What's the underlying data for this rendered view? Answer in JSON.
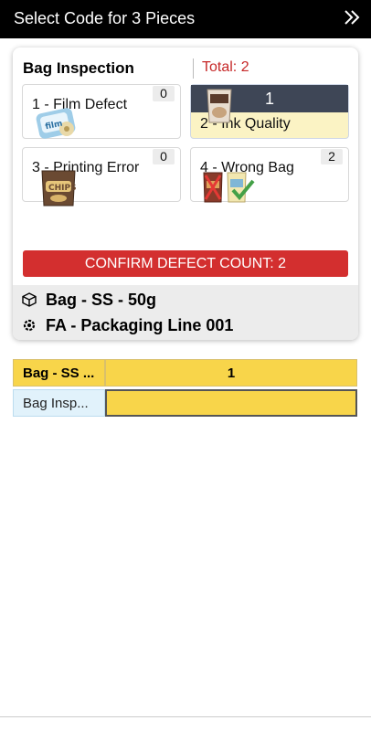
{
  "header": {
    "title": "Select Code for 3 Pieces",
    "expand_icon": "double-chevron-right-icon"
  },
  "card": {
    "title": "Bag Inspection",
    "total": "Total: 2",
    "tiles": [
      {
        "label": "1 - Film Defect",
        "count": "0",
        "selected": false
      },
      {
        "label": "2 - Ink Quality",
        "count": "1",
        "selected": true
      },
      {
        "label": "3 - Printing Error",
        "count": "0",
        "selected": false
      },
      {
        "label": "4 - Wrong Bag",
        "count": "2",
        "selected": false
      }
    ],
    "confirm_label": "CONFIRM DEFECT COUNT: 2",
    "info": {
      "product": "Bag - SS - 50g",
      "product_icon": "package-icon",
      "line": "FA - Packaging Line 001",
      "line_icon": "gear-target-icon"
    }
  },
  "grid": {
    "header_left": "Bag - SS ...",
    "header_right": "1",
    "row_label": "Bag Insp...",
    "row_value": ""
  },
  "colors": {
    "accent_red": "#d32f2f",
    "total_red": "#c62828",
    "yellow": "#f8d54a",
    "selected_dark": "#3e4656",
    "light_blue": "#e1f2fb"
  }
}
